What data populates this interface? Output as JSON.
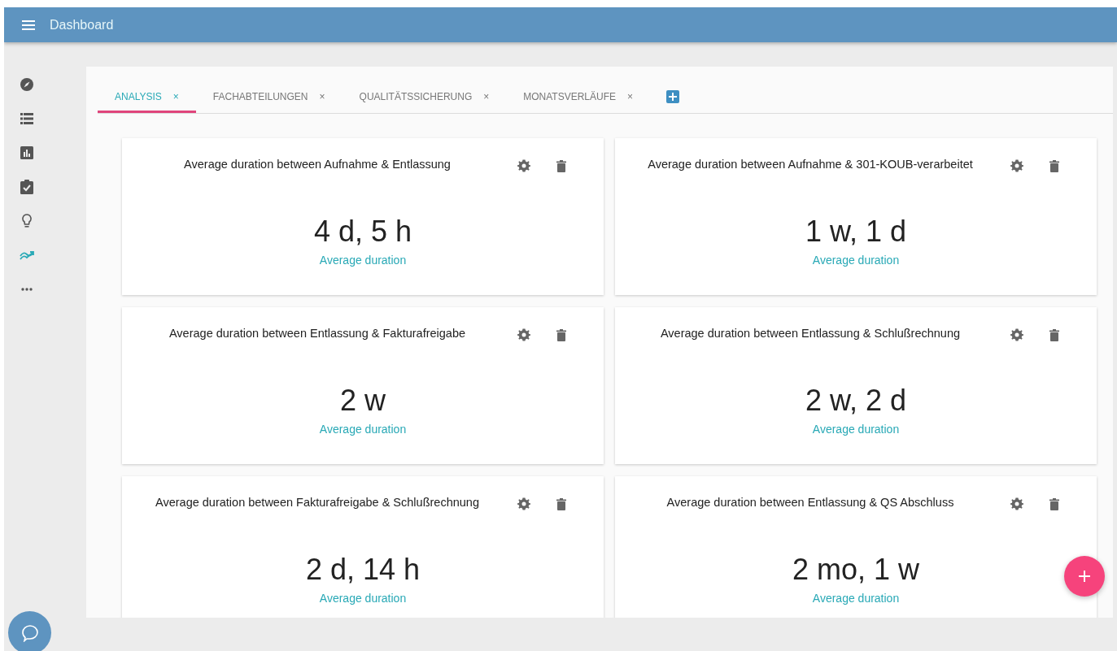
{
  "app_bar": {
    "title": "Dashboard"
  },
  "sidebar": {
    "items": [
      {
        "kind": "compass",
        "selected": false
      },
      {
        "kind": "list",
        "selected": false
      },
      {
        "kind": "chart",
        "selected": false
      },
      {
        "kind": "clipboard",
        "selected": false
      },
      {
        "kind": "bulb",
        "selected": false
      },
      {
        "kind": "trend",
        "selected": true
      },
      {
        "kind": "more",
        "selected": false
      }
    ]
  },
  "tabs": [
    {
      "label": "ANALYSIS",
      "close": "×",
      "selected": true
    },
    {
      "label": "FACHABTEILUNGEN",
      "close": "×",
      "selected": false
    },
    {
      "label": "QUALITÄTSSICHERUNG",
      "close": "×",
      "selected": false
    },
    {
      "label": "MONATSVERLÄUFE",
      "close": "×",
      "selected": false
    }
  ],
  "widgets": [
    {
      "title": "Average duration between Aufnahme & Entlassung",
      "value": "4 d, 5 h",
      "caption": "Average duration"
    },
    {
      "title": "Average duration between Aufnahme & 301-KOUB-verarbeitet",
      "value": "1 w, 1 d",
      "caption": "Average duration"
    },
    {
      "title": "Average duration between Entlassung & Fakturafreigabe",
      "value": "2 w",
      "caption": "Average duration"
    },
    {
      "title": "Average duration between Entlassung & Schlußrechnung",
      "value": "2 w, 2 d",
      "caption": "Average duration"
    },
    {
      "title": "Average duration between Fakturafreigabe & Schlußrechnung",
      "value": "2 d, 14 h",
      "caption": "Average duration"
    },
    {
      "title": "Average duration between Entlassung & QS Abschluss",
      "value": "2 mo, 1 w",
      "caption": "Average duration"
    }
  ]
}
